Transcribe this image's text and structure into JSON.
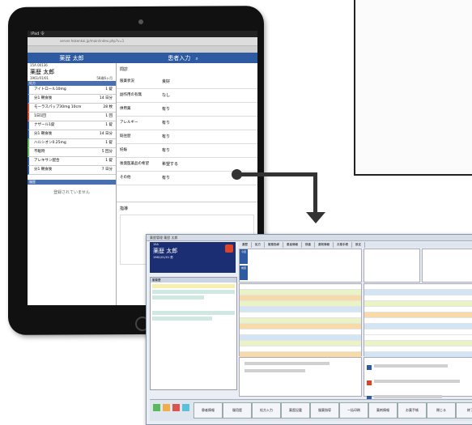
{
  "tablet": {
    "status_left": "iPad 令",
    "url": "server.hokenkai.jp/main/index.php?v=1",
    "header_patient": "薬歴 太郎",
    "header_mode": "患者入力",
    "patient": {
      "id": "15A 00136",
      "name": "薬歴 太郎",
      "birth": "1961/01/01",
      "age": "58歳6ヶ月"
    },
    "section_title": "処方",
    "meds": [
      {
        "name": "アイトロール10mg",
        "qty": "1 錠"
      },
      {
        "name": "分1 朝食後",
        "qty": "14 日分"
      },
      {
        "name": "モーラスパップ30mg 10cm",
        "qty": "28 枚"
      },
      {
        "name": "1日1回",
        "qty": "1 回"
      },
      {
        "name": "ナザール1錠",
        "qty": "1 錠"
      },
      {
        "name": "分1 朝食後",
        "qty": "14 日分"
      },
      {
        "name": "ハルシオン0.25mg",
        "qty": "1 錠"
      },
      {
        "name": "不眠時",
        "qty": "5 回分"
      },
      {
        "name": "アレキサン配合",
        "qty": "1 錠"
      },
      {
        "name": "分1 朝食後",
        "qty": "7 日分"
      }
    ],
    "history_title": "服歴",
    "empty_text": "登録されていません",
    "right_title": "問診",
    "interview": [
      {
        "label": "服薬状況",
        "value": "良好"
      },
      {
        "label": "副作用の有無",
        "value": "なし"
      },
      {
        "label": "併用薬",
        "value": "有り"
      },
      {
        "label": "アレルギー",
        "value": "有り"
      },
      {
        "label": "既往歴",
        "value": "有り"
      },
      {
        "label": "妊娠",
        "value": "有り"
      },
      {
        "label": "後発医薬品の希望",
        "value": "希望する"
      },
      {
        "label": "その他",
        "value": "有り"
      }
    ],
    "notes_title": "指導"
  },
  "desktop": {
    "title": "薬歴管理 薬歴 太郎",
    "patient_id": "15A",
    "patient_name": "薬歴 太郎",
    "patient_meta": "1961/01/01 男",
    "tabs": [
      "薬歴",
      "処方",
      "服薬指導",
      "患者情報",
      "検査",
      "薬剤情報",
      "お薬手帳",
      "設定"
    ],
    "tab_left": "今回",
    "tab_left2": "前回",
    "list_title": "服薬歴",
    "buttons": [
      "患者情報",
      "服用歴",
      "処方入力",
      "薬歴記載",
      "服薬指導",
      "一括印刷",
      "薬剤情報",
      "お薬手帳",
      "閉じる",
      "終了"
    ]
  }
}
